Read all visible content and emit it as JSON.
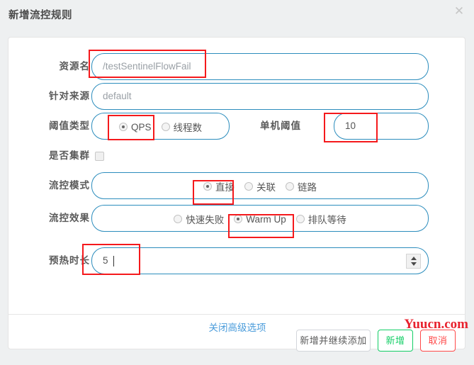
{
  "dialog": {
    "title": "新增流控规则",
    "close_icon": "close-icon"
  },
  "form": {
    "resource": {
      "label": "资源名",
      "value": "/testSentinelFlowFail",
      "placeholder": "资源名"
    },
    "origin": {
      "label": "针对来源",
      "value": "default",
      "placeholder": "default"
    },
    "threshold_type": {
      "label": "阈值类型",
      "options": [
        "QPS",
        "线程数"
      ],
      "selected": "QPS"
    },
    "single_threshold": {
      "label": "单机阈值",
      "value": "10"
    },
    "cluster": {
      "label": "是否集群",
      "checked": false
    },
    "flow_mode": {
      "label": "流控模式",
      "options": [
        "直接",
        "关联",
        "链路"
      ],
      "selected": "直接"
    },
    "flow_effect": {
      "label": "流控效果",
      "options": [
        "快速失败",
        "Warm Up",
        "排队等待"
      ],
      "selected": "Warm Up"
    },
    "warmup_duration": {
      "label": "预热时长",
      "value": "5",
      "spinner_icon": "spinner-up-down-icon"
    },
    "advanced_link": "关闭高级选项"
  },
  "footer": {
    "add_and_continue": "新增并继续添加",
    "add": "新增",
    "cancel": "取消"
  },
  "watermark": "Yuucn.com",
  "colors": {
    "accent": "#2c8dbd",
    "link": "#4a9cdb",
    "success": "#13ce66",
    "danger": "#ff4949",
    "highlight": "#f5191c",
    "watermark": "#e8222e"
  }
}
